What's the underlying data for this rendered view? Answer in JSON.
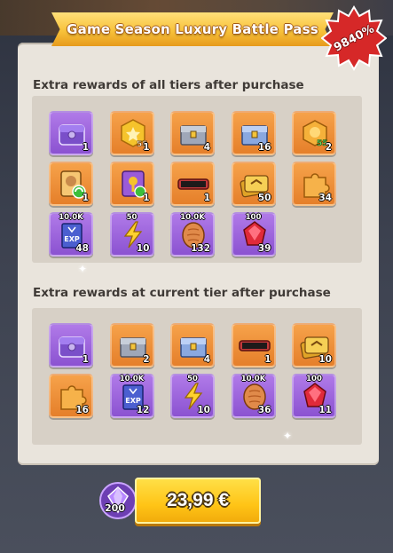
{
  "banner": {
    "title": "Game Season Luxury Battle Pass"
  },
  "discount_badge": {
    "text": "9840%"
  },
  "section_all": {
    "title": "Extra rewards of all tiers after purchase",
    "items": [
      {
        "icon": "purple-chest-icon",
        "qty": "1",
        "bg": "purple"
      },
      {
        "icon": "star-coin-55-icon",
        "qty": "1",
        "bg": "orange"
      },
      {
        "icon": "silver-chest-icon",
        "qty": "4",
        "bg": "orange"
      },
      {
        "icon": "blue-chest-icon",
        "qty": "16",
        "bg": "orange"
      },
      {
        "icon": "coin-55-icon",
        "qty": "2",
        "bg": "orange"
      },
      {
        "icon": "hero-refresh-card-icon",
        "qty": "1",
        "bg": "orange"
      },
      {
        "icon": "purple-key-card-icon",
        "qty": "1",
        "bg": "orange"
      },
      {
        "icon": "name-plate-icon",
        "qty": "1",
        "bg": "orange"
      },
      {
        "icon": "gold-cards-icon",
        "qty": "50",
        "bg": "orange"
      },
      {
        "icon": "puzzle-piece-icon",
        "qty": "34",
        "bg": "orange"
      },
      {
        "icon": "exp-book-icon",
        "qty": "48",
        "top": "10.0K",
        "bg": "purple"
      },
      {
        "icon": "lightning-icon",
        "qty": "10",
        "top": "50",
        "bg": "purple"
      },
      {
        "icon": "bread-icon",
        "qty": "132",
        "top": "10.0K",
        "bg": "purple"
      },
      {
        "icon": "ruby-icon",
        "qty": "39",
        "top": "100",
        "bg": "purple"
      }
    ]
  },
  "section_current": {
    "title": "Extra rewards at current tier after purchase",
    "items": [
      {
        "icon": "purple-chest-icon",
        "qty": "1",
        "bg": "purple"
      },
      {
        "icon": "silver-chest-icon",
        "qty": "2",
        "bg": "orange"
      },
      {
        "icon": "blue-chest-icon",
        "qty": "4",
        "bg": "orange"
      },
      {
        "icon": "name-plate-icon",
        "qty": "1",
        "bg": "orange"
      },
      {
        "icon": "gold-cards-icon",
        "qty": "10",
        "bg": "orange"
      },
      {
        "icon": "puzzle-piece-icon",
        "qty": "16",
        "bg": "orange"
      },
      {
        "icon": "exp-book-icon",
        "qty": "12",
        "top": "10.0K",
        "bg": "purple"
      },
      {
        "icon": "lightning-icon",
        "qty": "10",
        "top": "50",
        "bg": "purple"
      },
      {
        "icon": "bread-icon",
        "qty": "36",
        "top": "10.0K",
        "bg": "purple"
      },
      {
        "icon": "ruby-icon",
        "qty": "11",
        "top": "100",
        "bg": "purple"
      }
    ]
  },
  "purchase": {
    "gem_qty": "200",
    "price": "23,99 €"
  },
  "colors": {
    "accent_yellow": "#ffc416",
    "tile_orange": "#e57f2a",
    "tile_purple": "#8b52d1",
    "badge_red": "#d62828"
  }
}
